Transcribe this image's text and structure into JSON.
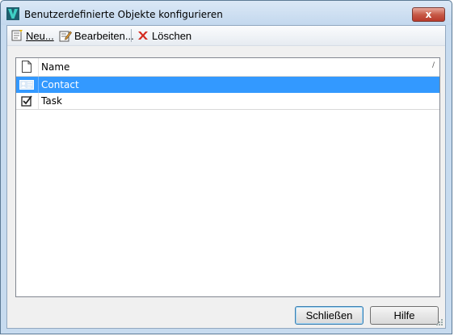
{
  "window": {
    "title": "Benutzerdefinierte Objekte konfigurieren",
    "close_symbol": "x"
  },
  "toolbar": {
    "new_label": "Neu...",
    "edit_label": "Bearbeiten...",
    "delete_label": "Löschen"
  },
  "list": {
    "header_name": "Name",
    "sort_indicator": "/",
    "rows": [
      {
        "label": "Contact",
        "icon": "contact-card-icon",
        "selected": true
      },
      {
        "label": "Task",
        "icon": "task-checkbox-icon",
        "selected": false
      }
    ]
  },
  "buttons": {
    "close_label": "Schließen",
    "help_label": "Hilfe"
  },
  "colors": {
    "selection": "#3399ff",
    "title_bar": "#c7dbef",
    "close_button": "#c75b48"
  }
}
